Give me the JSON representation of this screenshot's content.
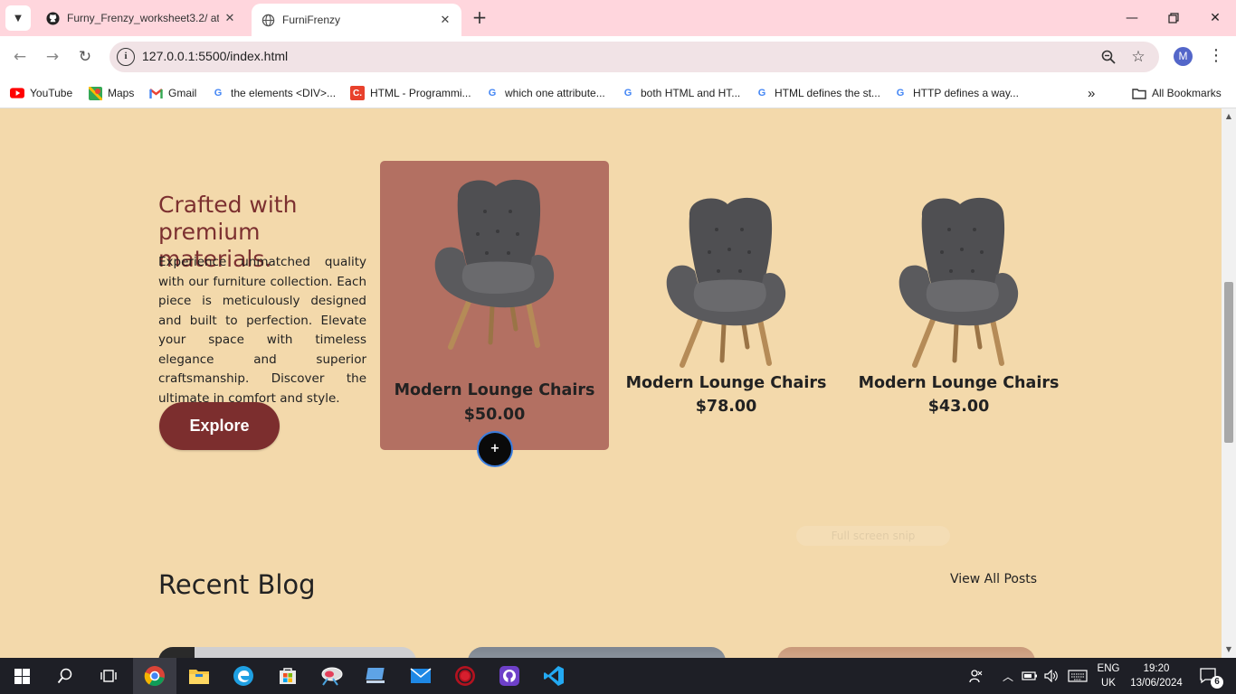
{
  "browser": {
    "tabs": [
      {
        "title": "Furny_Frenzy_worksheet3.2/ at",
        "icon": "github-icon",
        "active": false
      },
      {
        "title": "FurniFrenzy",
        "icon": "globe-icon",
        "active": true
      }
    ],
    "url": "127.0.0.1:5500/index.html",
    "profile_initial": "M",
    "bookmarks": [
      {
        "label": "YouTube",
        "icon": "youtube-icon"
      },
      {
        "label": "Maps",
        "icon": "maps-icon"
      },
      {
        "label": "Gmail",
        "icon": "gmail-icon"
      },
      {
        "label": "the elements <DIV>...",
        "icon": "google-icon"
      },
      {
        "label": "HTML - Programmi...",
        "icon": "chegg-icon"
      },
      {
        "label": "which one attribute...",
        "icon": "google-icon"
      },
      {
        "label": "both HTML and HT...",
        "icon": "google-icon"
      },
      {
        "label": "HTML defines the st...",
        "icon": "google-icon"
      },
      {
        "label": "HTTP defines a way...",
        "icon": "google-icon"
      }
    ],
    "all_bookmarks": "All Bookmarks"
  },
  "hero": {
    "heading": "Crafted with premium materials.",
    "text": "Experience unmatched quality with our furniture collection. Each piece is meticulously designed and built to perfection. Elevate your space with timeless elegance and superior craftsmanship. Discover the ultimate in comfort and style.",
    "button": "Explore"
  },
  "products": [
    {
      "name": "Modern Lounge Chairs",
      "price": "$50.00",
      "highlighted": true
    },
    {
      "name": "Modern Lounge Chairs",
      "price": "$78.00",
      "highlighted": false
    },
    {
      "name": "Modern Lounge Chairs",
      "price": "$43.00",
      "highlighted": false
    }
  ],
  "add_button": "+",
  "tooltip": "Full screen snip",
  "blog": {
    "title": "Recent Blog",
    "view_all": "View All Posts"
  },
  "taskbar": {
    "lang_top": "ENG",
    "lang_bottom": "UK",
    "time": "19:20",
    "date": "13/06/2024",
    "notifications": "6"
  },
  "colors": {
    "page_bg": "#f3d9ab",
    "accent": "#7c2e2e",
    "card_highlight": "#b37062",
    "tabbar": "#ffd6dd"
  }
}
